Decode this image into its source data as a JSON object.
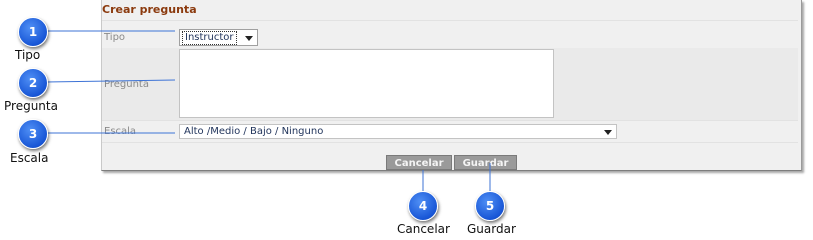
{
  "form": {
    "title": "Crear pregunta",
    "tipo": {
      "label": "Tipo",
      "value": "Instructor"
    },
    "pregunta": {
      "label": "Pregunta",
      "value": ""
    },
    "escala": {
      "label": "Escala",
      "value": "Alto /Medio / Bajo / Ninguno"
    },
    "buttons": {
      "cancel": "Cancelar",
      "save": "Guardar"
    }
  },
  "callouts": [
    {
      "number": "1",
      "caption": "Tipo"
    },
    {
      "number": "2",
      "caption": "Pregunta"
    },
    {
      "number": "3",
      "caption": "Escala"
    },
    {
      "number": "4",
      "caption": "Cancelar"
    },
    {
      "number": "5",
      "caption": "Guardar"
    }
  ],
  "colors": {
    "title": "#8b3a0e",
    "badge": "#1856d6",
    "button": "#9a9a9a"
  }
}
